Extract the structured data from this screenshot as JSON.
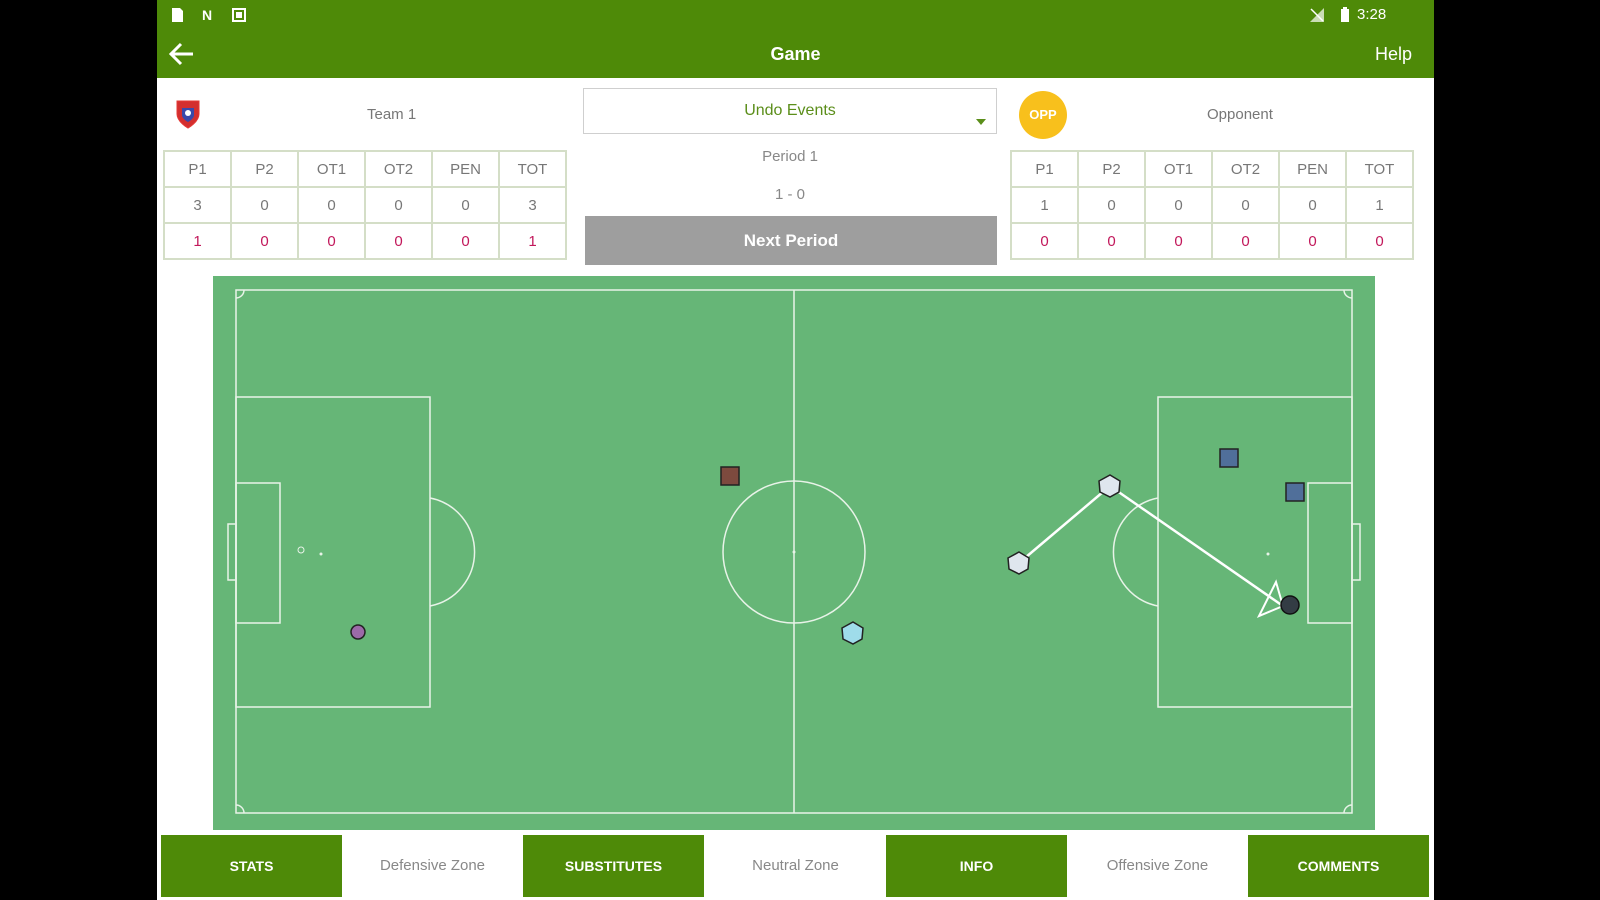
{
  "status_bar": {
    "left_icons": [
      "sd-card-icon",
      "nfc-icon",
      "notification-icon"
    ],
    "right_icons": [
      "signal-icon",
      "battery-icon"
    ],
    "time": "3:28"
  },
  "app_bar": {
    "title": "Game",
    "help_label": "Help"
  },
  "home_team": {
    "name": "Team 1",
    "table": {
      "headers": [
        "P1",
        "P2",
        "OT1",
        "OT2",
        "PEN",
        "TOT"
      ],
      "row_a": [
        "3",
        "0",
        "0",
        "0",
        "0",
        "3"
      ],
      "row_b": [
        "1",
        "0",
        "0",
        "0",
        "0",
        "1"
      ]
    }
  },
  "opponent_team": {
    "name": "Opponent",
    "badge": "OPP",
    "table": {
      "headers": [
        "P1",
        "P2",
        "OT1",
        "OT2",
        "PEN",
        "TOT"
      ],
      "row_a": [
        "1",
        "0",
        "0",
        "0",
        "0",
        "1"
      ],
      "row_b": [
        "0",
        "0",
        "0",
        "0",
        "0",
        "0"
      ]
    }
  },
  "center": {
    "undo_label": "Undo Events",
    "period_label": "Period 1",
    "score": "1 - 0",
    "next_period_label": "Next Period"
  },
  "colors": {
    "brand_green": "#4e8a08",
    "field_green": "#66b677",
    "opponent_badge": "#f8c01c",
    "secondary_stat_red": "#c2185b"
  },
  "bottom_bar": {
    "stats_label": "STATS",
    "defensive_zone_label": "Defensive Zone",
    "substitutes_label": "SUBSTITUTES",
    "neutral_zone_label": "Neutral Zone",
    "info_label": "INFO",
    "offensive_zone_label": "Offensive Zone",
    "comments_label": "COMMENTS"
  }
}
